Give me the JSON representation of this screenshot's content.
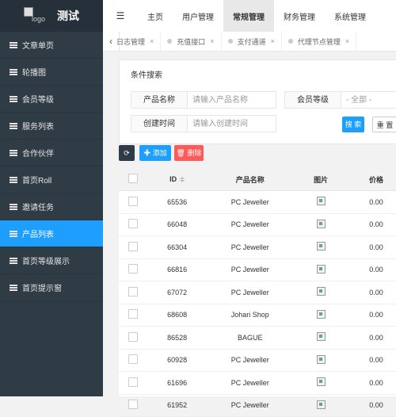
{
  "app": {
    "title": "测试",
    "logo_alt": "logo"
  },
  "sidebar": {
    "items": [
      {
        "label": "文章单页"
      },
      {
        "label": "轮播图"
      },
      {
        "label": "会员等级"
      },
      {
        "label": "服务列表"
      },
      {
        "label": "合作伙伴"
      },
      {
        "label": "首页Roll"
      },
      {
        "label": "邀请任务"
      },
      {
        "label": "产品列表",
        "active": true
      },
      {
        "label": "首页等级展示"
      },
      {
        "label": "首页提示窗"
      }
    ]
  },
  "topnav": {
    "items": [
      "主页",
      "用户管理",
      "常规管理",
      "财务管理",
      "系统管理"
    ],
    "active": "常规管理"
  },
  "tabs": [
    {
      "label": "日志管理"
    },
    {
      "label": "充值接口"
    },
    {
      "label": "支付通道"
    },
    {
      "label": "代理节点管理"
    }
  ],
  "search": {
    "title": "条件搜索",
    "product_label": "产品名称",
    "product_placeholder": "请输入产品名称",
    "level_label": "会员等级",
    "level_value": "- 全部 -",
    "time_label": "创建时间",
    "time_placeholder": "请输入创建时间",
    "search_button": "搜 索",
    "reset_button": "重 置"
  },
  "toolbar": {
    "add_label": "添加",
    "delete_label": "删除"
  },
  "table": {
    "headers": [
      "ID",
      "产品名称",
      "图片",
      "价格"
    ],
    "rows": [
      {
        "id": "65536",
        "name": "PC Jeweller",
        "price": "0.00"
      },
      {
        "id": "66048",
        "name": "PC Jeweller",
        "price": "0.00"
      },
      {
        "id": "66304",
        "name": "PC Jeweller",
        "price": "0.00"
      },
      {
        "id": "66816",
        "name": "PC Jeweller",
        "price": "0.00"
      },
      {
        "id": "67072",
        "name": "PC Jeweller",
        "price": "0.00"
      },
      {
        "id": "68608",
        "name": "Johari Shop",
        "price": "0.00"
      },
      {
        "id": "86528",
        "name": "BAGUE",
        "price": "0.00"
      },
      {
        "id": "60928",
        "name": "PC Jeweller",
        "price": "0.00"
      },
      {
        "id": "61696",
        "name": "PC Jeweller",
        "price": "0.00"
      },
      {
        "id": "61952",
        "name": "PC Jeweller",
        "price": "0.00"
      }
    ]
  },
  "colors": {
    "sidebar_bg": "#2f3b45",
    "active_blue": "#1e9fff",
    "delete_red": "#ff5a5a",
    "refresh_dark": "#2f3b45"
  }
}
